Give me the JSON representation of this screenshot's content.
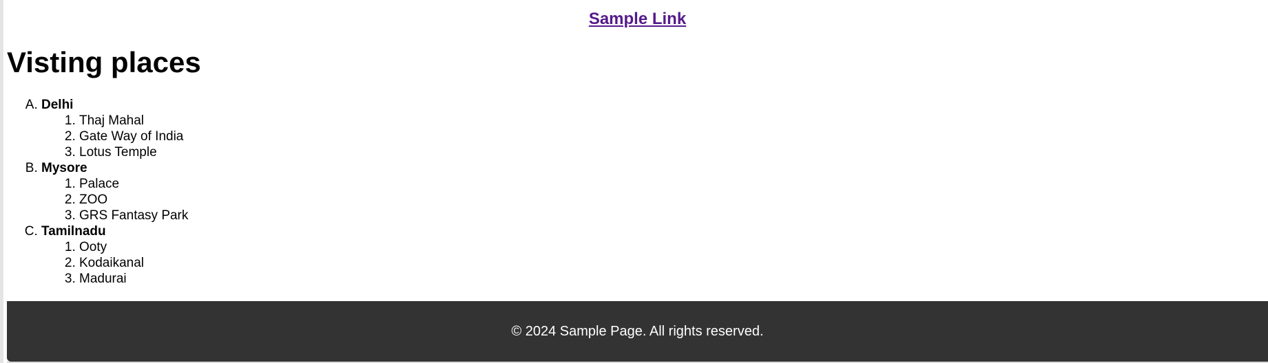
{
  "header": {
    "link_label": "Sample Link"
  },
  "main": {
    "title": "Visting places",
    "places": [
      {
        "marker": "A",
        "name": "Delhi",
        "spots": [
          "Thaj Mahal",
          "Gate Way of India",
          "Lotus Temple"
        ]
      },
      {
        "marker": "B",
        "name": "Mysore",
        "spots": [
          "Palace",
          "ZOO",
          "GRS Fantasy Park"
        ]
      },
      {
        "marker": "C",
        "name": "Tamilnadu",
        "spots": [
          "Ooty",
          "Kodaikanal",
          "Madurai"
        ]
      }
    ]
  },
  "footer": {
    "text": "© 2024 Sample Page. All rights reserved."
  },
  "colors": {
    "link": "#551a8b",
    "footer_bg": "#333333",
    "footer_text": "#ffffff"
  }
}
